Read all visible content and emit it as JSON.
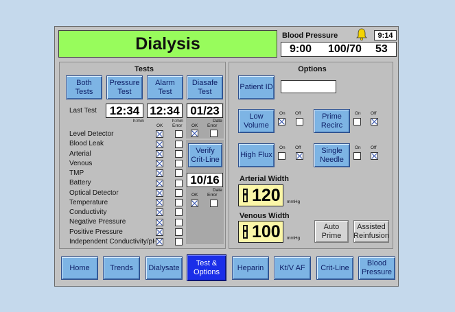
{
  "header": {
    "title": "Dialysis",
    "bp_label": "Blood Pressure",
    "clock": "9:14",
    "bp_time": "9:00",
    "bp_value": "100/70",
    "bp_pulse": "53"
  },
  "tests": {
    "title": "Tests",
    "buttons": {
      "both": "Both Tests",
      "pressure": "Pressure Test",
      "alarm": "Alarm Test",
      "diasafe": "Diasafe Test",
      "verify": "Verify Crit-Line"
    },
    "last_test_label": "Last Test",
    "last_test_time": "12:34",
    "last_test_time_unit": "h:min",
    "last_test_time2": "12:34",
    "last_test_time2_unit": "h:min",
    "diasafe_date": "01/23",
    "critline_date": "10/16",
    "ok_label": "OK",
    "error_label": "Error",
    "date_label": "Date",
    "items": [
      {
        "label": "Level Detector",
        "ok": true,
        "error": false
      },
      {
        "label": "Blood Leak",
        "ok": true,
        "error": false
      },
      {
        "label": "Arterial",
        "ok": true,
        "error": false
      },
      {
        "label": "Venous",
        "ok": true,
        "error": false
      },
      {
        "label": "TMP",
        "ok": true,
        "error": false
      },
      {
        "label": "Battery",
        "ok": true,
        "error": false
      },
      {
        "label": "Optical Detector",
        "ok": true,
        "error": false
      },
      {
        "label": "Temperature",
        "ok": true,
        "error": false
      },
      {
        "label": "Conductivity",
        "ok": true,
        "error": false
      },
      {
        "label": "Negative Pressure",
        "ok": true,
        "error": false
      },
      {
        "label": "Positive Pressure",
        "ok": true,
        "error": false
      },
      {
        "label": "Independent Conductivity/pH",
        "ok": true,
        "error": false
      }
    ],
    "diasafe_ok": true,
    "diasafe_error": false,
    "critline_ok": true,
    "critline_error": false
  },
  "options": {
    "title": "Options",
    "patient_id_label": "Patient ID",
    "patient_id_value": "",
    "on_label": "On",
    "off_label": "Off",
    "low_volume": {
      "label": "Low Volume",
      "on": true,
      "off": false
    },
    "prime_recirc": {
      "label": "Prime Recirc",
      "on": false,
      "off": true
    },
    "high_flux": {
      "label": "High Flux",
      "on": false,
      "off": true
    },
    "single_needle": {
      "label": "Single Needle",
      "on": false,
      "off": true
    },
    "arterial_width_label": "Arterial Width",
    "arterial_width_value": "120",
    "venous_width_label": "Venous Width",
    "venous_width_value": "100",
    "unit": "mmHg",
    "auto_prime": "Auto Prime",
    "assisted_reinfusion": "Assisted Reinfusion"
  },
  "nav": [
    "Home",
    "Trends",
    "Dialysate",
    "Test & Options",
    "Heparin",
    "Kt/V AF",
    "Crit-Line",
    "Blood Pressure"
  ],
  "colors": {
    "title_green": "#98fc5c",
    "button_blue": "#7db4e4",
    "active_tab": "#1a2ee8",
    "width_yellow": "#fbf6a8"
  }
}
